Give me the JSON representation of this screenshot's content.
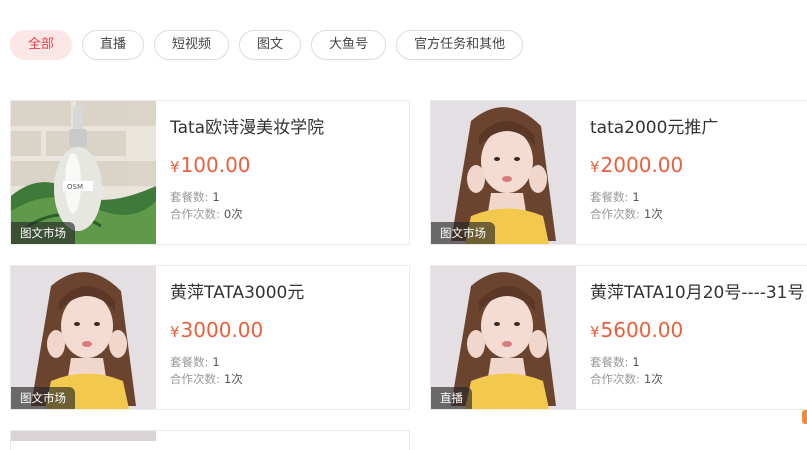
{
  "filters": [
    {
      "label": "全部",
      "active": true
    },
    {
      "label": "直播",
      "active": false
    },
    {
      "label": "短视频",
      "active": false
    },
    {
      "label": "图文",
      "active": false
    },
    {
      "label": "大鱼号",
      "active": false
    },
    {
      "label": "官方任务和其他",
      "active": false
    }
  ],
  "cards": [
    {
      "title": "Tata欧诗漫美妆学院",
      "currency": "¥",
      "price": "100.00",
      "packages_label": "套餐数:",
      "packages": "1",
      "coop_label": "合作次数:",
      "coop": "0次",
      "tag": "图文市场",
      "image": "product-bottle"
    },
    {
      "title": "tata2000元推广",
      "currency": "¥",
      "price": "2000.00",
      "packages_label": "套餐数:",
      "packages": "1",
      "coop_label": "合作次数:",
      "coop": "1次",
      "tag": "图文市场",
      "image": "portrait-yellow-dress"
    },
    {
      "title": "黄萍TATA3000元",
      "currency": "¥",
      "price": "3000.00",
      "packages_label": "套餐数:",
      "packages": "1",
      "coop_label": "合作次数:",
      "coop": "1次",
      "tag": "图文市场",
      "image": "portrait-yellow-dress"
    },
    {
      "title": "黄萍TATA10月20号----31号",
      "currency": "¥",
      "price": "5600.00",
      "packages_label": "套餐数:",
      "packages": "1",
      "coop_label": "合作次数:",
      "coop": "1次",
      "tag": "直播",
      "image": "portrait-yellow-dress"
    }
  ],
  "colors": {
    "accent": "#e8454c",
    "price": "#e8603c",
    "active_chip_bg": "#fde6e7"
  }
}
